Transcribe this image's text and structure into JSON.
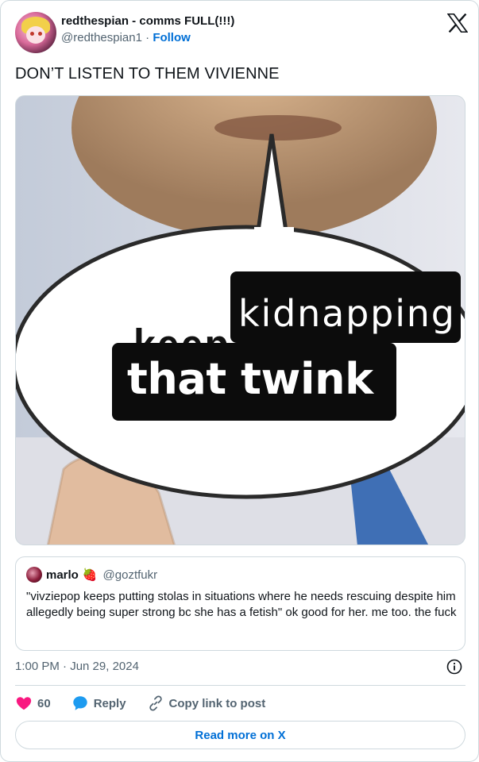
{
  "tweet": {
    "author": {
      "display_name": "redthespian - comms FULL(!!!)",
      "handle": "@redthespian1",
      "separator": "·",
      "follow_label": "Follow"
    },
    "text": "DON’T LISTEN TO THEM VIVIENNE",
    "media": {
      "caption_line1_word1": "keep",
      "caption_line1_word2": "kidnapping",
      "caption_line2": "that twink"
    },
    "quote": {
      "name": "marlo",
      "emoji": "🍓",
      "handle": "@goztfukr",
      "text": "\"vivziepop keeps putting stolas in situations where he needs rescuing despite him allegedly being super strong bc she has a fetish\" ok good for her. me too. the fuck"
    },
    "timestamp": "1:00 PM · Jun 29, 2024",
    "actions": {
      "like_count": "60",
      "reply_label": "Reply",
      "copy_label": "Copy link to post"
    },
    "read_more_label": "Read more on X"
  },
  "colors": {
    "link_blue": "#006fd6",
    "like_pink": "#f91880",
    "reply_blue": "#1d9bf0",
    "secondary_text": "#536471",
    "border": "#cfd9de"
  },
  "icons": [
    "x-logo-icon",
    "info-icon",
    "heart-icon",
    "reply-bubble-icon",
    "link-icon"
  ]
}
